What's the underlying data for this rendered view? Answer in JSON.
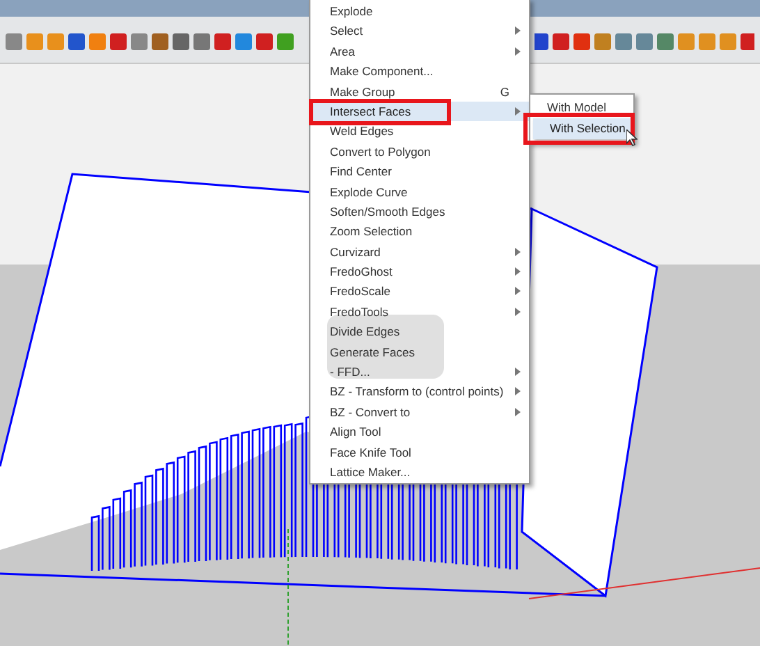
{
  "context_menu": {
    "items": [
      {
        "label": "Explode",
        "has_submenu": false,
        "selected": false,
        "annotated": false
      },
      {
        "label": "Select",
        "has_submenu": true,
        "selected": false,
        "annotated": false
      },
      {
        "label": "Area",
        "has_submenu": true,
        "selected": false,
        "annotated": false
      },
      {
        "label": "Make Component...",
        "has_submenu": false,
        "selected": false,
        "annotated": false
      },
      {
        "label": "Make Group",
        "shortcut": "G",
        "has_submenu": false,
        "selected": false,
        "annotated": false
      },
      {
        "label": "Intersect Faces",
        "has_submenu": true,
        "selected": true,
        "annotated": true
      },
      {
        "label": "Weld Edges",
        "has_submenu": false,
        "selected": false,
        "annotated": false
      },
      {
        "label": "Convert to Polygon",
        "has_submenu": false,
        "selected": false,
        "annotated": false
      },
      {
        "label": "Find Center",
        "has_submenu": false,
        "selected": false,
        "annotated": false
      },
      {
        "label": "Explode Curve",
        "has_submenu": false,
        "selected": false,
        "annotated": false
      },
      {
        "label": "Soften/Smooth Edges",
        "has_submenu": false,
        "selected": false,
        "annotated": false
      },
      {
        "label": "Zoom Selection",
        "has_submenu": false,
        "selected": false,
        "annotated": false
      },
      {
        "label": "Curvizard",
        "has_submenu": true,
        "selected": false,
        "annotated": false
      },
      {
        "label": "FredoGhost",
        "has_submenu": true,
        "selected": false,
        "annotated": false
      },
      {
        "label": "FredoScale",
        "has_submenu": true,
        "selected": false,
        "annotated": false
      },
      {
        "label": "FredoTools",
        "has_submenu": true,
        "selected": false,
        "annotated": false
      },
      {
        "label": "Divide Edges",
        "has_submenu": false,
        "selected": false,
        "annotated": false
      },
      {
        "label": "Generate Faces",
        "has_submenu": false,
        "selected": false,
        "annotated": false
      },
      {
        "label": "- FFD...",
        "has_submenu": true,
        "selected": false,
        "annotated": false
      },
      {
        "label": "BZ - Transform to (control points)",
        "has_submenu": true,
        "selected": false,
        "annotated": false
      },
      {
        "label": "BZ - Convert to",
        "has_submenu": true,
        "selected": false,
        "annotated": false
      },
      {
        "label": "Align Tool",
        "has_submenu": false,
        "selected": false,
        "annotated": false
      },
      {
        "label": "Face Knife Tool",
        "has_submenu": false,
        "selected": false,
        "annotated": false
      },
      {
        "label": "Lattice Maker...",
        "has_submenu": false,
        "selected": false,
        "annotated": false
      }
    ]
  },
  "submenu": {
    "items": [
      {
        "label": "With Model",
        "selected": false,
        "annotated": false
      },
      {
        "label": "With Selection",
        "selected": true,
        "annotated": true
      }
    ]
  }
}
